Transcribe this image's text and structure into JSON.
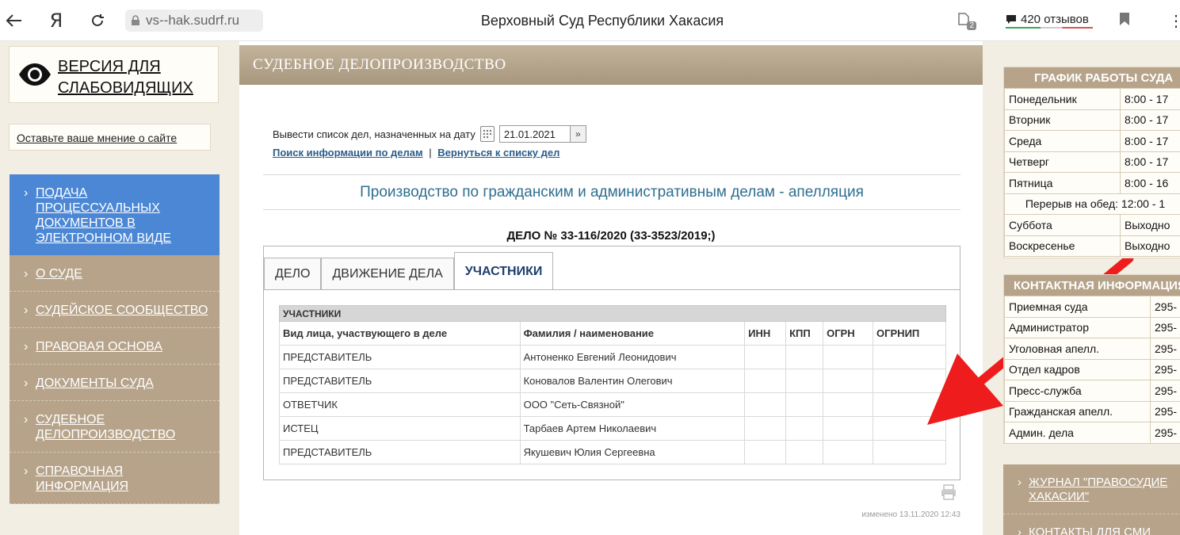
{
  "browser": {
    "ya_label": "Я",
    "url": "vs--hak.sudrf.ru",
    "title": "Верховный Суд Республики Хакасия",
    "ext_count": "2",
    "reviews": "420 отзывов"
  },
  "left": {
    "vi_text": "ВЕРСИЯ ДЛЯ СЛАБОВИДЯЩИХ",
    "opinion": "Оставьте ваше мнение о сайте",
    "menu": [
      {
        "label": "Подача процессуальных документов в электронном виде",
        "active": true
      },
      {
        "label": "О суде"
      },
      {
        "label": "Судейское сообщество"
      },
      {
        "label": "Правовая основа"
      },
      {
        "label": "Документы суда"
      },
      {
        "label": "Судебное делопроизводство"
      },
      {
        "label": "Справочная информация"
      }
    ]
  },
  "main": {
    "header": "СУДЕБНОЕ ДЕЛОПРОИЗВОДСТВО",
    "date_label": "Вывести список дел, назначенных на дату",
    "date_value": "21.01.2021",
    "link_search": "Поиск информации по делам",
    "link_sep": "|",
    "link_back": "Вернуться к списку дел",
    "section_title": "Производство по гражданским и административным делам - апелляция",
    "case_title": "ДЕЛО № 33-116/2020 (33-3523/2019;)",
    "tabs": [
      "ДЕЛО",
      "ДВИЖЕНИЕ ДЕЛА",
      "УЧАСТНИКИ"
    ],
    "table": {
      "caption": "УЧАСТНИКИ",
      "headers": [
        "Вид лица, участвующего в деле",
        "Фамилия / наименование",
        "ИНН",
        "КПП",
        "ОГРН",
        "ОГРНИП"
      ],
      "rows": [
        [
          "ПРЕДСТАВИТЕЛЬ",
          "Антоненко Евгений Леонидович"
        ],
        [
          "ПРЕДСТАВИТЕЛЬ",
          "Коновалов Валентин Олегович"
        ],
        [
          "ОТВЕТЧИК",
          "ООО \"Сеть-Связной\""
        ],
        [
          "ИСТЕЦ",
          "Тарбаев Артем Николаевич"
        ],
        [
          "ПРЕДСТАВИТЕЛЬ",
          "Якушевич Юлия Сергеевна"
        ]
      ]
    },
    "modified": "изменено 13.11.2020 12:43"
  },
  "right": {
    "schedule_title": "ГРАФИК РАБОТЫ СУДА",
    "schedule": [
      [
        "Понедельник",
        "8:00 - 17"
      ],
      [
        "Вторник",
        "8:00 - 17"
      ],
      [
        "Среда",
        "8:00 - 17"
      ],
      [
        "Четверг",
        "8:00 - 17"
      ],
      [
        "Пятница",
        "8:00 - 16"
      ]
    ],
    "lunch": "Перерыв на обед: 12:00 - 1",
    "weekend": [
      [
        "Суббота",
        "Выходно"
      ],
      [
        "Воскресенье",
        "Выходно"
      ]
    ],
    "contacts_title": "КОНТАКТНАЯ ИНФОРМАЦИЯ",
    "contacts": [
      [
        "Приемная суда",
        "295-"
      ],
      [
        "Администратор",
        "295-"
      ],
      [
        "Уголовная апелл.",
        "295-"
      ],
      [
        "Отдел кадров",
        "295-"
      ],
      [
        "Пресс-служба",
        "295-"
      ],
      [
        "Гражданская апелл.",
        "295-"
      ],
      [
        "Админ. дела",
        "295-"
      ]
    ],
    "menu": [
      "ЖУРНАЛ \"ПРАВОСУДИЕ ХАКАСИИ\"",
      "КОНТАКТЫ ДЛЯ СМИ"
    ]
  },
  "colors": {
    "accent_blue": "#4b87d4",
    "menu_tan": "#b6a38a",
    "arrow_red": "#ee1c1c"
  }
}
